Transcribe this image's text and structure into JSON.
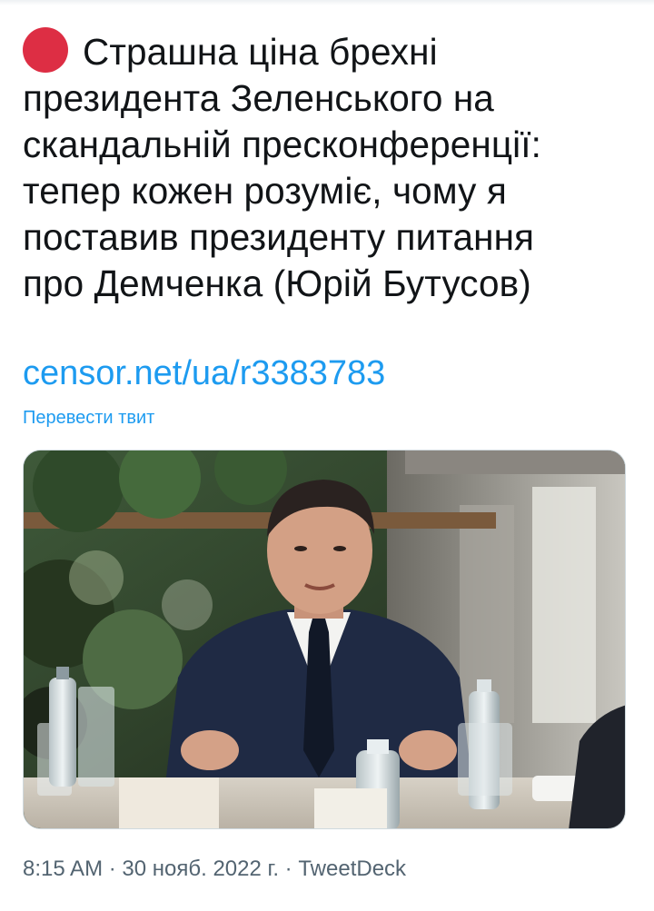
{
  "tweet": {
    "headline_lines": [
      "Страшна ціна брехні",
      "президента Зеленського на",
      "скандальній пресконференції:",
      "тепер кожен розуміє, чому я",
      "поставив президенту питання",
      "про Демченка (Юрій Бутусов)"
    ],
    "headline_emoji": "red-circle",
    "link_text": "censor.net/ua/r3383783",
    "translate_label": "Перевести твит",
    "media": {
      "type": "photo"
    },
    "time": "8:15 AM",
    "separator": "·",
    "date": "30 нояб. 2022 г.",
    "source": "TweetDeck"
  },
  "colors": {
    "link": "#1d9bf0",
    "emoji_red": "#dd2e44",
    "meta_text": "#536471",
    "body_text": "#0f1419"
  }
}
